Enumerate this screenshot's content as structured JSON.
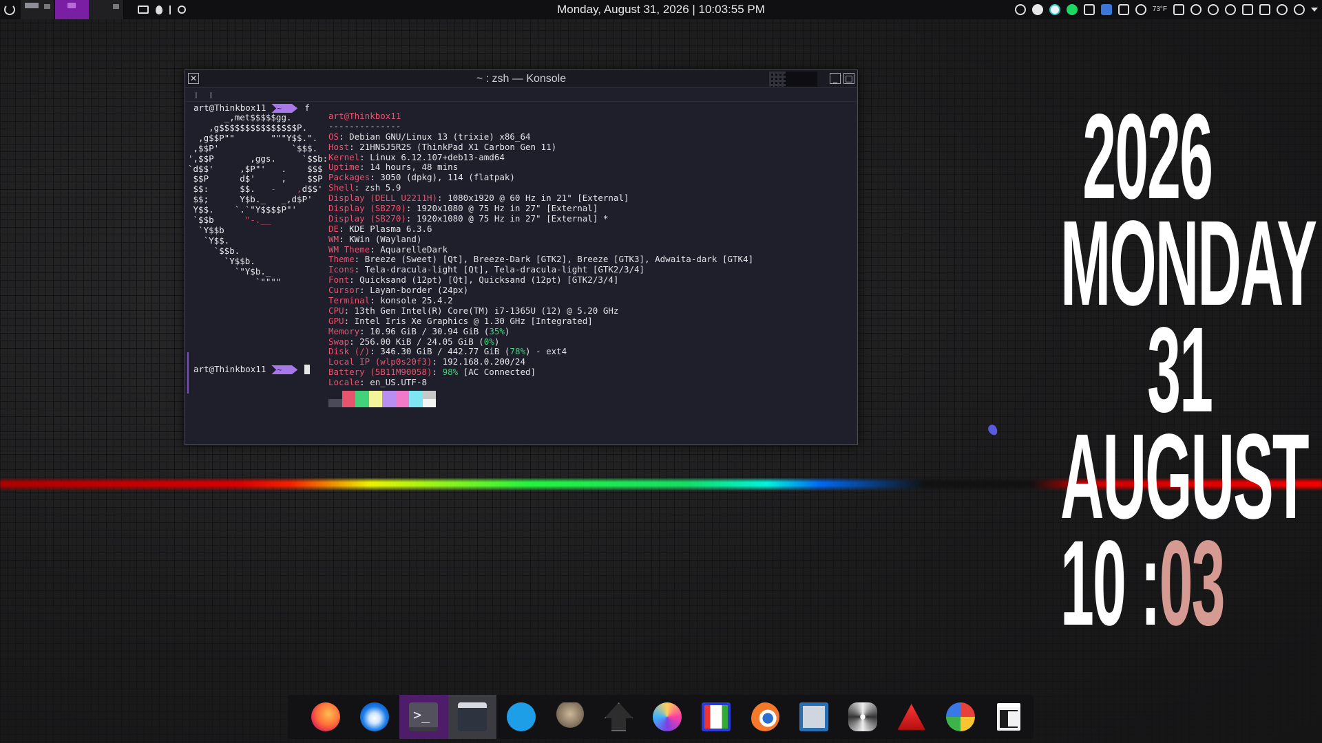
{
  "top_panel": {
    "datetime": "Monday, August 31, 2026 | 10:03:55 PM",
    "tray_temp": "73°F"
  },
  "konsole": {
    "title": "~ : zsh — Konsole",
    "prompt_user": "art@Thinkbox11",
    "prompt_dir": "~",
    "command": "f",
    "ascii_art": [
      "       _,met$$$$$gg.",
      "    ,g$$$$$$$$$$$$$$$P.",
      "  ,g$$P\"\"       \"\"\"Y$$.\".",
      " ,$$P'              `$$$.",
      "',$$P       ,ggs.     `$$b:",
      "`d$$'     ,$P\"'   .    $$$",
      " $$P      d$'     ,    $$P",
      " $$:      $$.   -    ,d$$'",
      " $$;      Y$b._   _,d$P'",
      " Y$$.    `.`\"Y$$$$P\"'",
      " `$$b      \"-.__",
      "  `Y$$b",
      "   `Y$$.",
      "     `$$b.",
      "       `Y$$b.",
      "         `\"Y$b._",
      "             `\"\"\"\""
    ],
    "info_header": "art@Thinkbox11",
    "info_separator": "--------------",
    "info": [
      {
        "k": "OS",
        "v": ": Debian GNU/Linux 13 (trixie) x86_64"
      },
      {
        "k": "Host",
        "v": ": 21HNSJ5R2S (ThinkPad X1 Carbon Gen 11)"
      },
      {
        "k": "Kernel",
        "v": ": Linux 6.12.107+deb13-amd64"
      },
      {
        "k": "Uptime",
        "v": ": 14 hours, 48 mins"
      },
      {
        "k": "Packages",
        "v": ": 3050 (dpkg), 114 (flatpak)"
      },
      {
        "k": "Shell",
        "v": ": zsh 5.9"
      },
      {
        "k": "Display (DELL U2211H)",
        "v": ": 1080x1920 @ 60 Hz in 21\" [External]"
      },
      {
        "k": "Display (SB270)",
        "v": ": 1920x1080 @ 75 Hz in 27\" [External]"
      },
      {
        "k": "Display (SB270)",
        "v": ": 1920x1080 @ 75 Hz in 27\" [External] *"
      },
      {
        "k": "DE",
        "v": ": KDE Plasma 6.3.6"
      },
      {
        "k": "WM",
        "v": ": KWin (Wayland)"
      },
      {
        "k": "WM Theme",
        "v": ": AquarelleDark"
      },
      {
        "k": "Theme",
        "v": ": Breeze (Sweet) [Qt], Breeze-Dark [GTK2], Breeze [GTK3], Adwaita-dark [GTK4]"
      },
      {
        "k": "Icons",
        "v": ": Tela-dracula-light [Qt], Tela-dracula-light [GTK2/3/4]"
      },
      {
        "k": "Font",
        "v": ": Quicksand (12pt) [Qt], Quicksand (12pt) [GTK2/3/4]"
      },
      {
        "k": "Cursor",
        "v": ": Layan-border (24px)"
      },
      {
        "k": "Terminal",
        "v": ": konsole 25.4.2"
      },
      {
        "k": "CPU",
        "v": ": 13th Gen Intel(R) Core(TM) i7-1365U (12) @ 5.20 GHz"
      },
      {
        "k": "GPU",
        "v": ": Intel Iris Xe Graphics @ 1.30 GHz [Integrated]"
      },
      {
        "k": "Memory",
        "v": ": 10.96 GiB / 30.94 GiB (",
        "g": "35%",
        "t": ")"
      },
      {
        "k": "Swap",
        "v": ": 256.00 KiB / 24.05 GiB (",
        "g": "0%",
        "t": ")"
      },
      {
        "k": "Disk (/)",
        "v": ": 346.30 GiB / 442.77 GiB (",
        "g": "78%",
        "t": ") - ext4"
      },
      {
        "k": "Local IP (wlp0s20f3)",
        "v": ": 192.168.0.200/24"
      },
      {
        "k": "Battery (5B11M90058)",
        "v": ": ",
        "g": "98%",
        "t": " [AC Connected]"
      },
      {
        "k": "Locale",
        "v": ": en_US.UTF-8"
      }
    ],
    "palette_top": [
      "#1f1f2b",
      "#e8536e",
      "#43d17a",
      "#f4f59a",
      "#b98ef2",
      "#f07ac8",
      "#7ee6f0",
      "#c8c8c8"
    ],
    "palette_bottom": [
      "#4a4a58",
      "#e8536e",
      "#43d17a",
      "#f4f59a",
      "#b98ef2",
      "#f07ac8",
      "#7ee6f0",
      "#f4f4f4"
    ]
  },
  "big_clock": {
    "year": "2026",
    "weekday": "MONDAY",
    "day": "31",
    "month": "AUGUST",
    "hour": "10",
    "sep": ":",
    "minute": "03",
    "minute_color": "#d59a92"
  },
  "dock": {
    "apps": [
      "firefox-icon",
      "thunderbird-icon",
      "konsole-icon",
      "dolphin-icon",
      "kite-icon",
      "gimp-icon",
      "inkscape-icon",
      "krita-icon",
      "grid-app-icon",
      "blender-icon",
      "screen-app-icon",
      "atom-app-icon",
      "red-triangle-icon",
      "pie-app-icon",
      "trash-icon"
    ],
    "accent": "#4e1d6a"
  }
}
